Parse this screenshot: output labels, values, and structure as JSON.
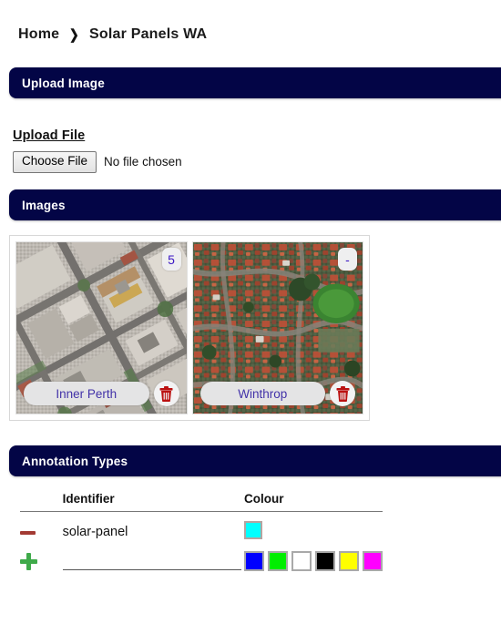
{
  "breadcrumb": {
    "home_label": "Home",
    "separator": "chevron-right-icon",
    "current_label": "Solar Panels WA"
  },
  "sections": {
    "upload": {
      "title": "Upload Image"
    },
    "images": {
      "title": "Images"
    },
    "annotations": {
      "title": "Annotation Types"
    }
  },
  "upload": {
    "label": "Upload File",
    "button_label": "Choose File",
    "status_text": "No file chosen"
  },
  "images": {
    "cards": [
      {
        "name": "Inner Perth",
        "badge": "5",
        "delete_icon": "trash-icon"
      },
      {
        "name": "Winthrop",
        "badge": "-",
        "delete_icon": "trash-icon"
      }
    ]
  },
  "annotation_types": {
    "headers": {
      "action": "",
      "identifier": "Identifier",
      "colour": "Colour"
    },
    "rows": [
      {
        "action_icon": "minus-icon",
        "identifier": "solar-panel",
        "colour": "#00FFFF"
      }
    ],
    "new_row": {
      "action_icon": "plus-icon",
      "identifier_value": "",
      "identifier_placeholder": "",
      "palette": [
        "#0000FF",
        "#00EE00",
        "#FFFFFF",
        "#000000",
        "#FFFF00",
        "#FF00FF"
      ]
    }
  },
  "colors": {
    "section_bar": "#030546",
    "badge_text": "#3b17c4",
    "chip_text": "#4232a8",
    "trash_icon": "#bb1111",
    "minus_icon": "#a33a33",
    "plus_icon": "#3faa4a"
  }
}
